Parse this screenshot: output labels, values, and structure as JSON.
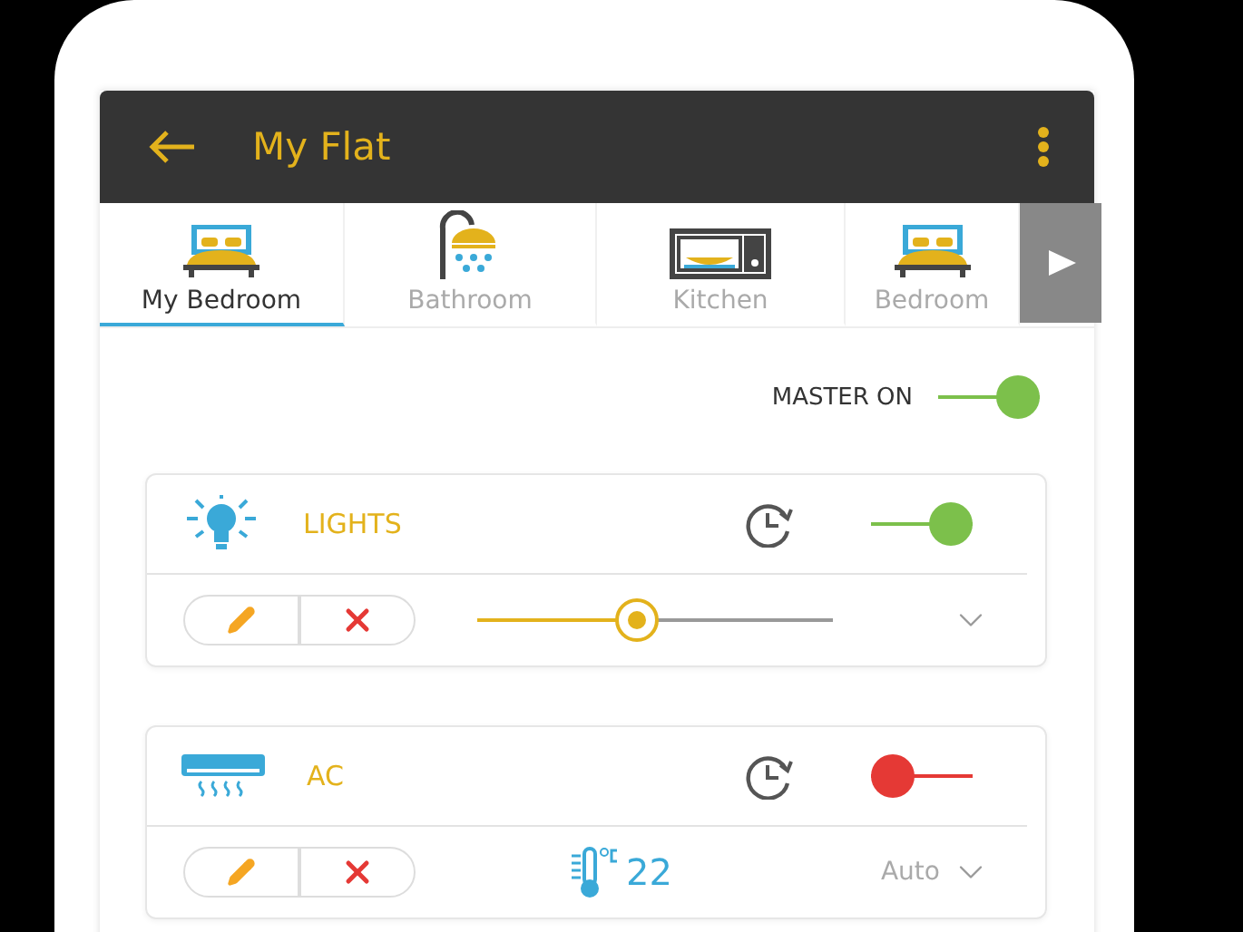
{
  "app_bar": {
    "title": "My Flat"
  },
  "rooms": [
    {
      "label": "My Bedroom",
      "kind": "bed",
      "selected": true
    },
    {
      "label": "Bathroom",
      "kind": "shower",
      "selected": false
    },
    {
      "label": "Kitchen",
      "kind": "microwave",
      "selected": false
    },
    {
      "label": "Bedroom",
      "kind": "bed",
      "selected": false
    }
  ],
  "master": {
    "label": "MASTER ON",
    "on": true
  },
  "devices": [
    {
      "kind": "lights",
      "name": "LIGHTS",
      "on": true,
      "level": 0.45
    },
    {
      "kind": "ac",
      "name": "AC",
      "on": false,
      "temperature": "22",
      "mode": "Auto"
    }
  ]
}
